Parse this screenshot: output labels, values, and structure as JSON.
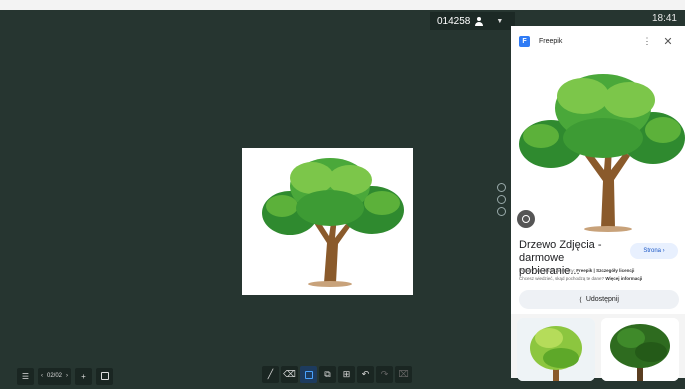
{
  "status_bar": {
    "session_code": "014258",
    "time": "18:41"
  },
  "lens_panel": {
    "site_name": "Freepik",
    "site_icon_letter": "F",
    "result_title": "Drzewo Zdjęcia - darmowe pobieranie...",
    "visit_button": "Strona ›",
    "source_prefix": "Pobierz ten obraz ze strony:",
    "source_value": "Freepik | Szczegóły licencji",
    "info_text": "Chcesz wiedzieć, skąd pochodzą te dane?",
    "info_link": "Więcej informacji",
    "share_button": "Udostępnij"
  },
  "bottom_toolbar": {
    "page_indicator": "02/02"
  },
  "colors": {
    "board": "#263530",
    "accent": "#2f7bf5"
  }
}
